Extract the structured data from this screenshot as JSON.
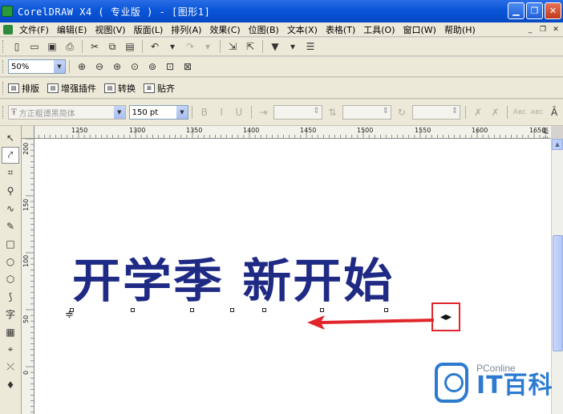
{
  "window": {
    "title": "CorelDRAW X4 ( 专业版 ) - [图形1]",
    "min_label": "▁",
    "max_label": "❐",
    "close_label": "✕"
  },
  "menu": {
    "items": [
      "文件(F)",
      "编辑(E)",
      "视图(V)",
      "版面(L)",
      "排列(A)",
      "效果(C)",
      "位图(B)",
      "文本(X)",
      "表格(T)",
      "工具(O)",
      "窗口(W)",
      "帮助(H)"
    ],
    "doc_min": "_",
    "doc_restore": "❐",
    "doc_close": "✕"
  },
  "zoom": {
    "value": "50%"
  },
  "plugins": {
    "layout": "排版",
    "enhance": "增强插件",
    "convert": "转换",
    "paste": "贴齐"
  },
  "text_props": {
    "font": "方正粗谭黑简体",
    "size": "150 pt"
  },
  "ruler": {
    "h_labels": [
      "1250",
      "1300",
      "1350",
      "1400",
      "1450",
      "1500",
      "1550",
      "1600",
      "1650"
    ],
    "h_unit": "毫米",
    "v_labels": [
      "200",
      "150",
      "100",
      "50",
      "0"
    ]
  },
  "canvas": {
    "headline": "开学季 新开始"
  },
  "watermark": {
    "site": "PConline",
    "brand": "IT百科"
  },
  "colors": {
    "headline": "#1f2a85",
    "arrow": "#e0262b",
    "titlebar": "#0a56d8"
  }
}
